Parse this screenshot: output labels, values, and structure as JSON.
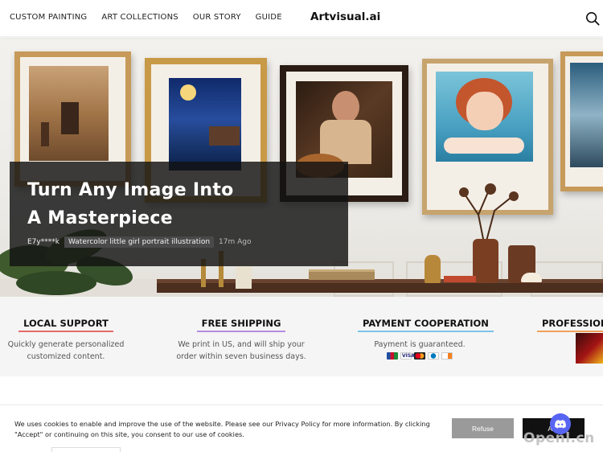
{
  "header": {
    "nav": [
      "CUSTOM PAINTING",
      "ART COLLECTIONS",
      "OUR STORY",
      "GUIDE"
    ],
    "brand": "Artvisual.ai",
    "search_icon": "search-icon"
  },
  "hero": {
    "headline_line1": "Turn Any Image Into",
    "headline_line2": "A Masterpiece",
    "user": "E7y****k",
    "tag": "Watercolor little girl portrait illustration",
    "time": "17m Ago"
  },
  "features": [
    {
      "title": "LOCAL SUPPORT",
      "desc_line1": "Quickly generate personalized",
      "desc_line2": "customized content.",
      "accent": "#e66a6a"
    },
    {
      "title": "FREE SHIPPING",
      "desc_line1": "We print in US, and will ship your",
      "desc_line2": "order within seven business days.",
      "accent": "#b48be0"
    },
    {
      "title": "PAYMENT COOPERATION",
      "desc_line1": "Payment is guaranteed.",
      "desc_line2": "",
      "accent": "#7cc3e8"
    },
    {
      "title": "PROFESSIONA",
      "desc_line1": "",
      "desc_line2": "",
      "accent": "#f0a15a"
    }
  ],
  "payment_icons": [
    "jcb-icon",
    "visa-icon",
    "mastercard-icon",
    "diners-icon",
    "discover-icon"
  ],
  "cookie": {
    "text": "We uses cookies to enable and improve the use of the website. Please see our Privacy Policy for more information. By clicking \"Accept\" or continuing on this site, you consent to our use of cookies.",
    "refuse": "Refuse",
    "accept": "Acc"
  },
  "watermark": "Openl.cn",
  "colors": {
    "overlay": "#121212",
    "refuse": "#9a9a9a",
    "accept": "#111111",
    "discord": "#5865f2"
  }
}
